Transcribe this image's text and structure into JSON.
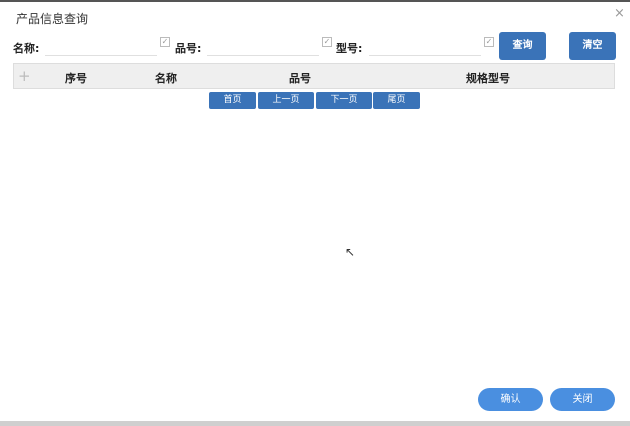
{
  "dialog": {
    "title": "产品信息查询",
    "close": "×"
  },
  "search": {
    "name_label": "名称:",
    "name_value": "",
    "code_label": "品号:",
    "code_value": "",
    "model_label": "型号:",
    "model_value": "",
    "query_button": "查询",
    "clear_button": "清空"
  },
  "table": {
    "add_icon": "+",
    "columns": [
      "序号",
      "名称",
      "品号",
      "规格型号"
    ]
  },
  "pagination": {
    "first": "首页",
    "prev": "上一页",
    "next": "下一页",
    "last": "尾页"
  },
  "footer": {
    "confirm": "确认",
    "close": "关闭"
  }
}
